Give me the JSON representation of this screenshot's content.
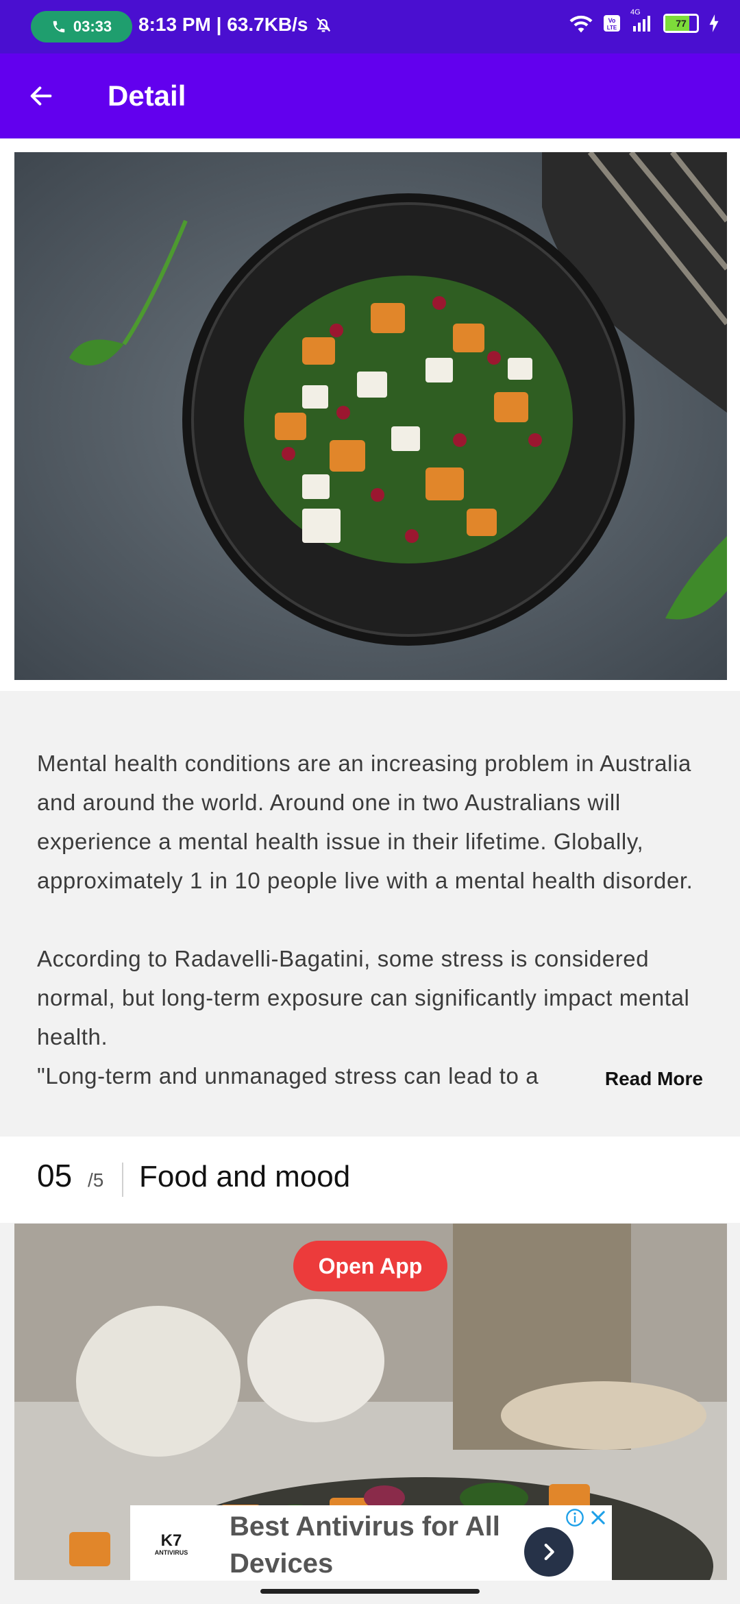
{
  "status_bar": {
    "call_time": "03:33",
    "time_speed": "8:13 PM | 63.7KB/s",
    "network_label": "4G",
    "battery_level": "77"
  },
  "app_bar": {
    "title": "Detail"
  },
  "article": {
    "paragraph_1": "Mental health conditions are an increasing problem in Australia and around the world. Around one in two Australians will experience a mental health issue in their lifetime. Globally, approximately 1 in 10 people live with a mental health disorder.",
    "paragraph_2": "According to Radavelli-Bagatini, some stress is considered normal, but long-term exposure can significantly impact mental health.",
    "paragraph_3": "\"Long-term and unmanaged stress can lead to a",
    "read_more": "Read More"
  },
  "section": {
    "index": "05",
    "total": "/5",
    "title": "Food and mood"
  },
  "open_app_label": "Open App",
  "ad": {
    "brand": "K7",
    "brand_sub": "ANTIVIRUS",
    "headline": "Best Antivirus for All Devices"
  }
}
